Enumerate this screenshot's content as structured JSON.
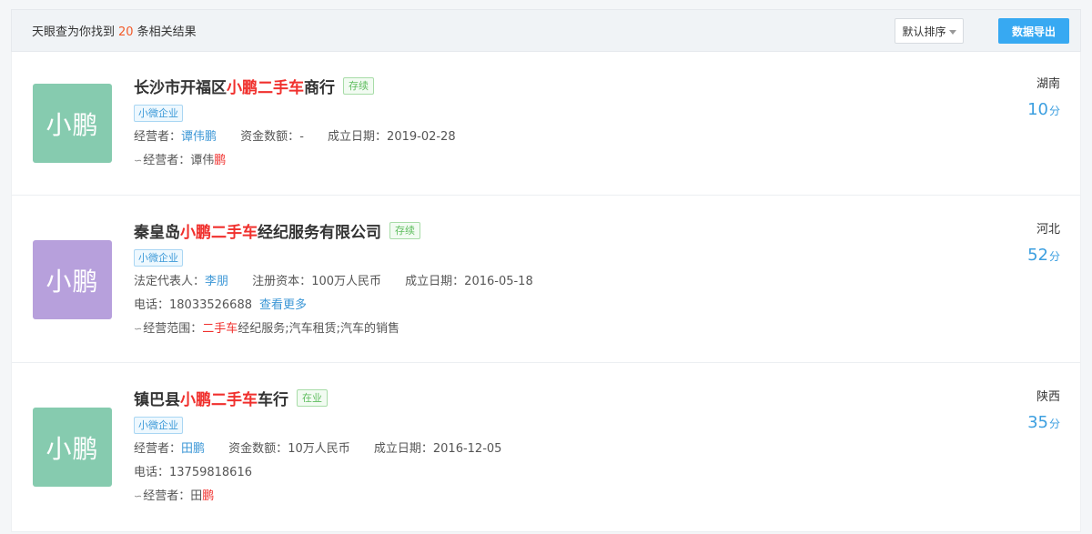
{
  "header": {
    "summary_prefix": "天眼查为你找到",
    "count": "20",
    "summary_suffix": "条相关结果",
    "sort_label": "默认排序",
    "export_label": "数据导出"
  },
  "colors": {
    "highlight": "#f0302d",
    "link": "#3c97d6",
    "export_button": "#37a9f2",
    "status_green": "#5ebd5e",
    "logo_green": "#86cbaf",
    "logo_purple": "#b7a0dc"
  },
  "results": [
    {
      "logo_text": "小鹏",
      "logo_color": "#86cbaf",
      "name_pre": "长沙市开福区",
      "name_hl": "小鹏二手车",
      "name_post": "商行",
      "status": "存续",
      "tag": "小微企业",
      "person_label": "经营者：",
      "person": "谭伟鹏",
      "capital_label": "资金数额：",
      "capital": "-",
      "date_label": "成立日期：",
      "date": "2019-02-28",
      "foot_label": "经营者：",
      "foot_pre": "谭伟",
      "foot_hl": "鹏",
      "foot_post": "",
      "region": "湖南",
      "score": "10",
      "score_unit": "分"
    },
    {
      "logo_text": "小鹏",
      "logo_color": "#b7a0dc",
      "name_pre": "秦皇岛",
      "name_hl": "小鹏二手车",
      "name_post": "经纪服务有限公司",
      "status": "存续",
      "tag": "小微企业",
      "person_label": "法定代表人：",
      "person": "李朋",
      "capital_label": "注册资本：",
      "capital": "100万人民币",
      "date_label": "成立日期：",
      "date": "2016-05-18",
      "phone_label": "电话：",
      "phone": "18033526688",
      "more_label": "查看更多",
      "foot_label": "经营范围：",
      "foot_pre": "",
      "foot_hl": "二手车",
      "foot_post": "经纪服务;汽车租赁;汽车的销售",
      "region": "河北",
      "score": "52",
      "score_unit": "分"
    },
    {
      "logo_text": "小鹏",
      "logo_color": "#86cbaf",
      "name_pre": "镇巴县",
      "name_hl": "小鹏二手车",
      "name_post": "车行",
      "status": "在业",
      "tag": "小微企业",
      "person_label": "经营者：",
      "person": "田鹏",
      "capital_label": "资金数额：",
      "capital": "10万人民币",
      "date_label": "成立日期：",
      "date": "2016-12-05",
      "phone_label": "电话：",
      "phone": "13759818616",
      "foot_label": "经营者：",
      "foot_pre": "田",
      "foot_hl": "鹏",
      "foot_post": "",
      "region": "陕西",
      "score": "35",
      "score_unit": "分"
    }
  ]
}
